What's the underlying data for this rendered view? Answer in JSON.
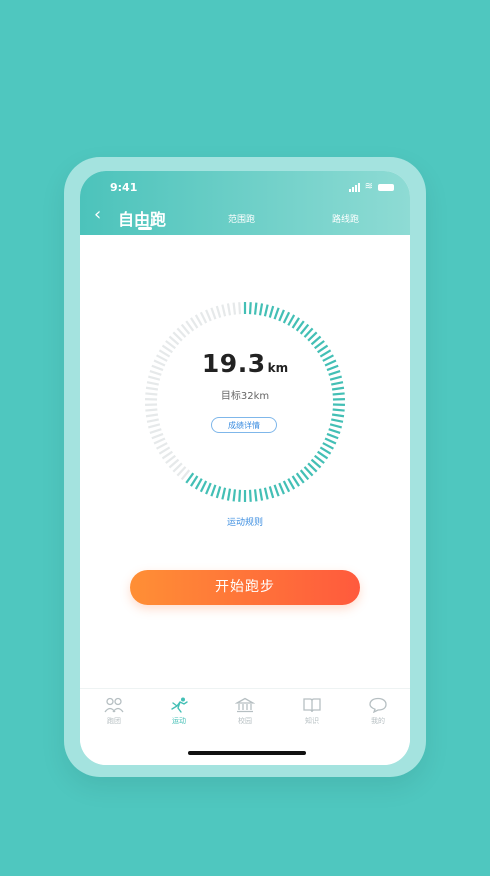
{
  "status": {
    "time": "9:41"
  },
  "header": {
    "tabs": [
      {
        "label": "自由跑",
        "active": true
      },
      {
        "label": "范围跑",
        "active": false
      },
      {
        "label": "路线跑",
        "active": false
      }
    ]
  },
  "progress": {
    "distance_value": "19.3",
    "distance_unit": "km",
    "goal_text": "目标32km",
    "progress_fraction": 0.603,
    "detail_button": "成绩详情"
  },
  "rules_link": "运动规则",
  "start_button": "开始跑步",
  "bottom_nav": [
    {
      "label": "跑团",
      "icon": "group-icon",
      "active": false
    },
    {
      "label": "运动",
      "icon": "running-icon",
      "active": true
    },
    {
      "label": "校园",
      "icon": "campus-icon",
      "active": false
    },
    {
      "label": "知识",
      "icon": "book-icon",
      "active": false
    },
    {
      "label": "我的",
      "icon": "profile-icon",
      "active": false
    }
  ],
  "colors": {
    "background": "#4fc7bf",
    "accent": "#43bfb5",
    "ring_inactive": "#e6e9ea",
    "start_gradient_from": "#ff8f35",
    "start_gradient_to": "#ff5a3d",
    "link": "#3b8de0"
  }
}
